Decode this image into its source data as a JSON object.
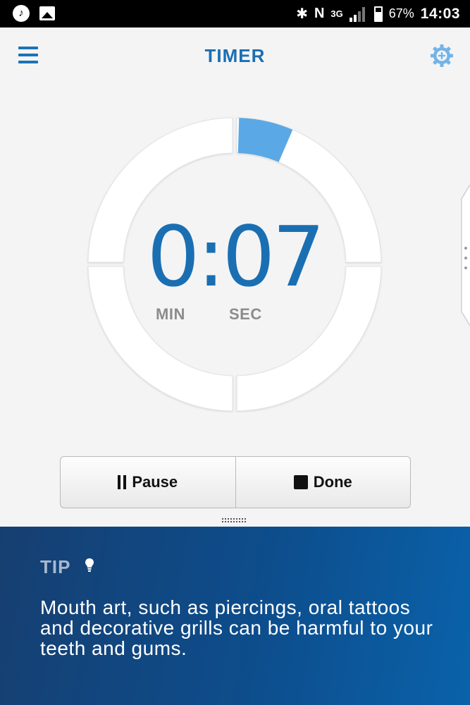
{
  "status_bar": {
    "left_icons": [
      "music-note-icon",
      "image-icon"
    ],
    "network": "3G",
    "battery_percent": "67%",
    "time": "14:03"
  },
  "header": {
    "title": "TIMER",
    "menu_icon": "hamburger-menu-icon",
    "settings_icon": "gear-plus-icon"
  },
  "timer": {
    "display": "0:07",
    "min_label": "MIN",
    "sec_label": "SEC",
    "progress_fraction": 0.06
  },
  "controls": {
    "pause_label": "Pause",
    "done_label": "Done"
  },
  "tip": {
    "label": "TIP",
    "text": "Mouth art, such as piercings, oral tattoos and decorative grills can be harmful to your teeth and gums."
  },
  "colors": {
    "accent": "#1a6fb3",
    "progress": "#5aa9e6",
    "tip_bg": "#0d4d8c"
  }
}
